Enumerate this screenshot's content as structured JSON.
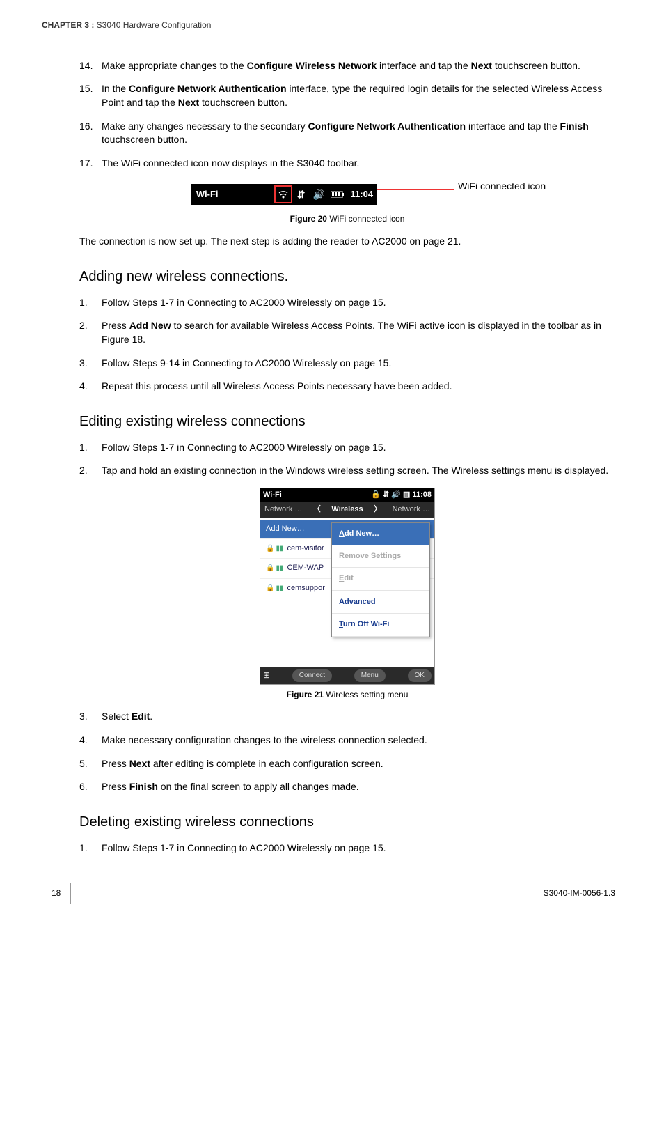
{
  "running_head": {
    "chapter_label": "CHAPTER 3 :",
    "chapter_title": " S3040 Hardware Configuration"
  },
  "steps_a": [
    {
      "num": "14.",
      "pre": "Make appropriate changes to the ",
      "b1": "Configure Wireless Network",
      "mid": " interface and tap the ",
      "b2": "Next",
      "post": " touchscreen button."
    },
    {
      "num": "15.",
      "pre": "In the ",
      "b1": "Configure Network Authentication",
      "mid": " interface, type the required login details for the selected Wireless Access Point and tap the ",
      "b2": "Next",
      "post": " touchscreen button."
    },
    {
      "num": "16.",
      "pre": "Make any changes necessary to the secondary ",
      "b1": "Configure Network Authentication",
      "mid": " interface and tap the ",
      "b2": "Finish",
      "post": " touchscreen button."
    },
    {
      "num": "17.",
      "pre": "The WiFi connected icon now displays in the S3040 toolbar.",
      "b1": "",
      "mid": "",
      "b2": "",
      "post": ""
    }
  ],
  "fig20": {
    "toolbar_label": "Wi-Fi",
    "time": "11:04",
    "annotation": "WiFi connected icon",
    "caption_label": "Figure 20",
    "caption_text": " WiFi connected icon"
  },
  "para_conn": "The connection is now set up. The next step is adding the reader to AC2000 on page 21.",
  "h_add": "Adding new wireless connections.",
  "steps_add": [
    {
      "num": "1.",
      "text": "Follow Steps 1-7 in Connecting to AC2000 Wirelessly on page 15."
    },
    {
      "num": "2.",
      "pre": "Press ",
      "b1": "Add New",
      "post": " to search for available Wireless Access Points. The WiFi active icon is displayed in the toolbar as in Figure 18."
    },
    {
      "num": "3.",
      "text": "Follow Steps 9-14 in Connecting to AC2000 Wirelessly on page 15."
    },
    {
      "num": "4.",
      "text": "Repeat this process until all Wireless Access Points necessary have been added."
    }
  ],
  "h_edit": "Editing existing wireless connections",
  "steps_edit_pre": [
    {
      "num": "1.",
      "text": "Follow Steps 1-7 in Connecting to AC2000 Wirelessly on page 15."
    },
    {
      "num": "2.",
      "text": "Tap and hold an existing connection in the Windows wireless setting screen. The Wireless settings menu is displayed."
    }
  ],
  "fig21": {
    "status_left": "Wi-Fi",
    "status_time": "11:08",
    "tab_left": "Network …",
    "tab_center": "Wireless",
    "tab_right": "Network …",
    "rows": {
      "addnew": "Add New…",
      "r1": "cem-visitor",
      "r2": "CEM-WAP",
      "r3": "cemsuppor"
    },
    "menu": {
      "m1a": "A",
      "m1b": "dd New…",
      "m2a": "R",
      "m2b": "emove Settings",
      "m3a": "E",
      "m3b": "dit",
      "m4a": "d",
      "m4pre": "A",
      "m4post": "vanced",
      "m5a": "T",
      "m5b": "urn Off Wi-Fi"
    },
    "soft_left": "Connect",
    "soft_right": "Menu",
    "soft_ok": "OK",
    "caption_label": "Figure 21",
    "caption_text": " Wireless setting menu"
  },
  "steps_edit_post": [
    {
      "num": "3.",
      "pre": "Select ",
      "b1": "Edit",
      "post": "."
    },
    {
      "num": "4.",
      "text": "Make necessary configuration changes to the wireless connection selected."
    },
    {
      "num": "5.",
      "pre": "Press ",
      "b1": "Next",
      "post": " after editing is complete in each configuration screen."
    },
    {
      "num": "6.",
      "pre": "Press ",
      "b1": "Finish",
      "post": " on the final screen to apply all changes made."
    }
  ],
  "h_del": "Deleting existing wireless connections",
  "steps_del": [
    {
      "num": "1.",
      "text": "Follow Steps 1-7 in Connecting to AC2000 Wirelessly on page 15."
    }
  ],
  "footer": {
    "page": "18",
    "docid": "S3040-IM-0056-1.3"
  }
}
